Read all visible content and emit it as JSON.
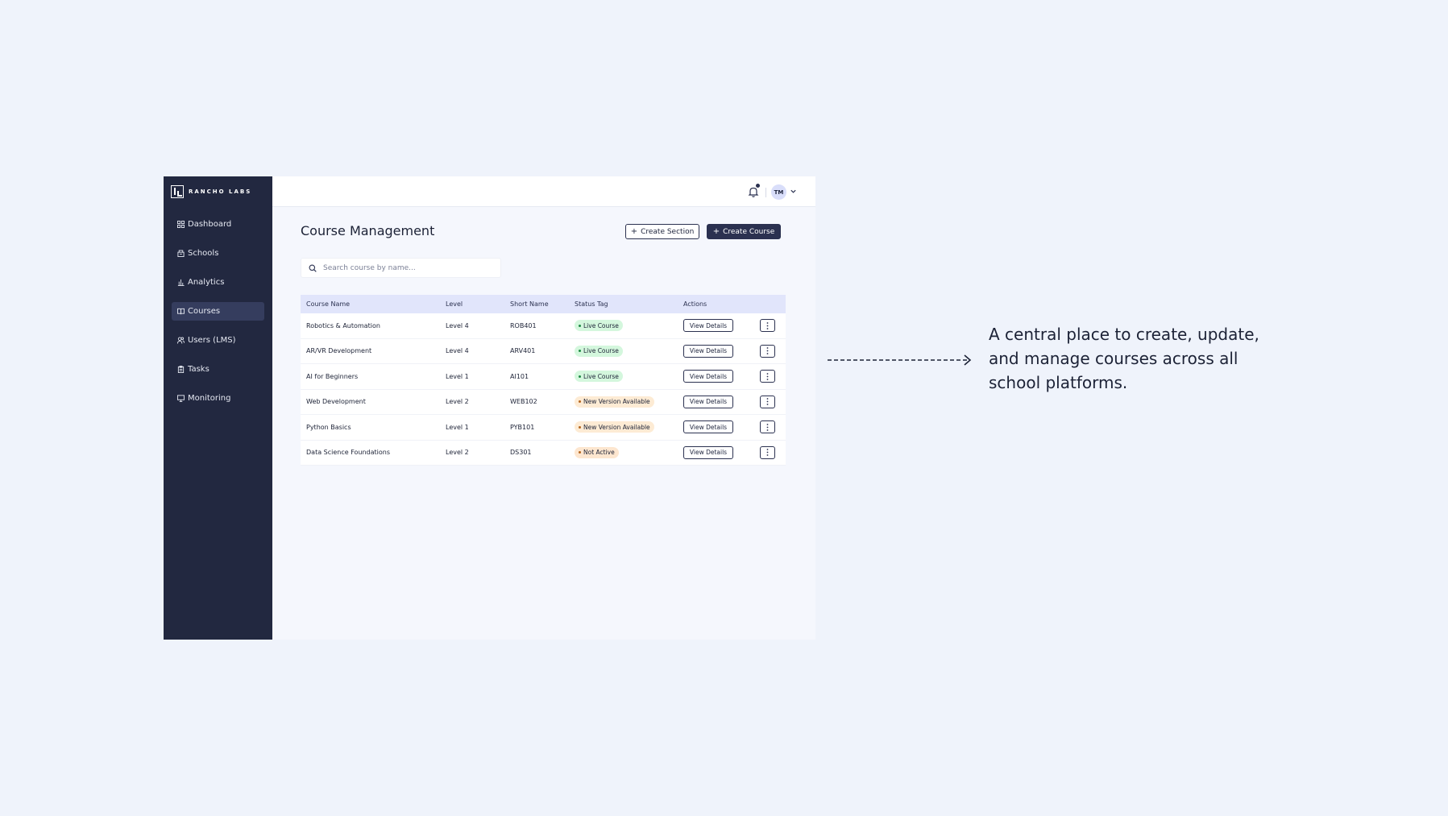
{
  "brand": {
    "name": "RANCHO LABS"
  },
  "sidebar": {
    "items": [
      {
        "label": "Dashboard",
        "icon": "dashboard-icon"
      },
      {
        "label": "Schools",
        "icon": "school-icon"
      },
      {
        "label": "Analytics",
        "icon": "analytics-icon"
      },
      {
        "label": "Courses",
        "icon": "courses-icon",
        "active": true
      },
      {
        "label": "Users (LMS)",
        "icon": "users-icon"
      },
      {
        "label": "Tasks",
        "icon": "tasks-icon"
      },
      {
        "label": "Monitoring",
        "icon": "monitor-icon"
      }
    ]
  },
  "header": {
    "avatar_initials": "TM"
  },
  "page": {
    "title": "Course Management",
    "create_section_label": "Create Section",
    "create_course_label": "Create Course"
  },
  "search": {
    "placeholder": "Search course by name..."
  },
  "table": {
    "columns": [
      "Course Name",
      "Level",
      "Short Name",
      "Status Tag",
      "Actions"
    ],
    "action_label": "View Details",
    "rows": [
      {
        "name": "Robotics & Automation",
        "level": "Level 4",
        "short": "ROB401",
        "status": "Live Course",
        "status_type": "live"
      },
      {
        "name": "AR/VR Development",
        "level": "Level 4",
        "short": "ARV401",
        "status": "Live Course",
        "status_type": "live"
      },
      {
        "name": "AI for Beginners",
        "level": "Level 1",
        "short": "AI101",
        "status": "Live Course",
        "status_type": "live"
      },
      {
        "name": "Web Development",
        "level": "Level 2",
        "short": "WEB102",
        "status": "New Version Available",
        "status_type": "newver"
      },
      {
        "name": "Python Basics",
        "level": "Level 1",
        "short": "PYB101",
        "status": "New Version Available",
        "status_type": "newver"
      },
      {
        "name": "Data Science Foundations",
        "level": "Level 2",
        "short": "DS301",
        "status": "Not Active",
        "status_type": "inactive"
      }
    ]
  },
  "annotation": {
    "text": "A central place to create, update, and manage courses across all school platforms."
  },
  "colors": {
    "sidebar_bg": "#222840",
    "primary": "#2b3150",
    "page_bg": "#eff3fb",
    "live": "#d4f7dd",
    "warning": "#fdebd4"
  }
}
